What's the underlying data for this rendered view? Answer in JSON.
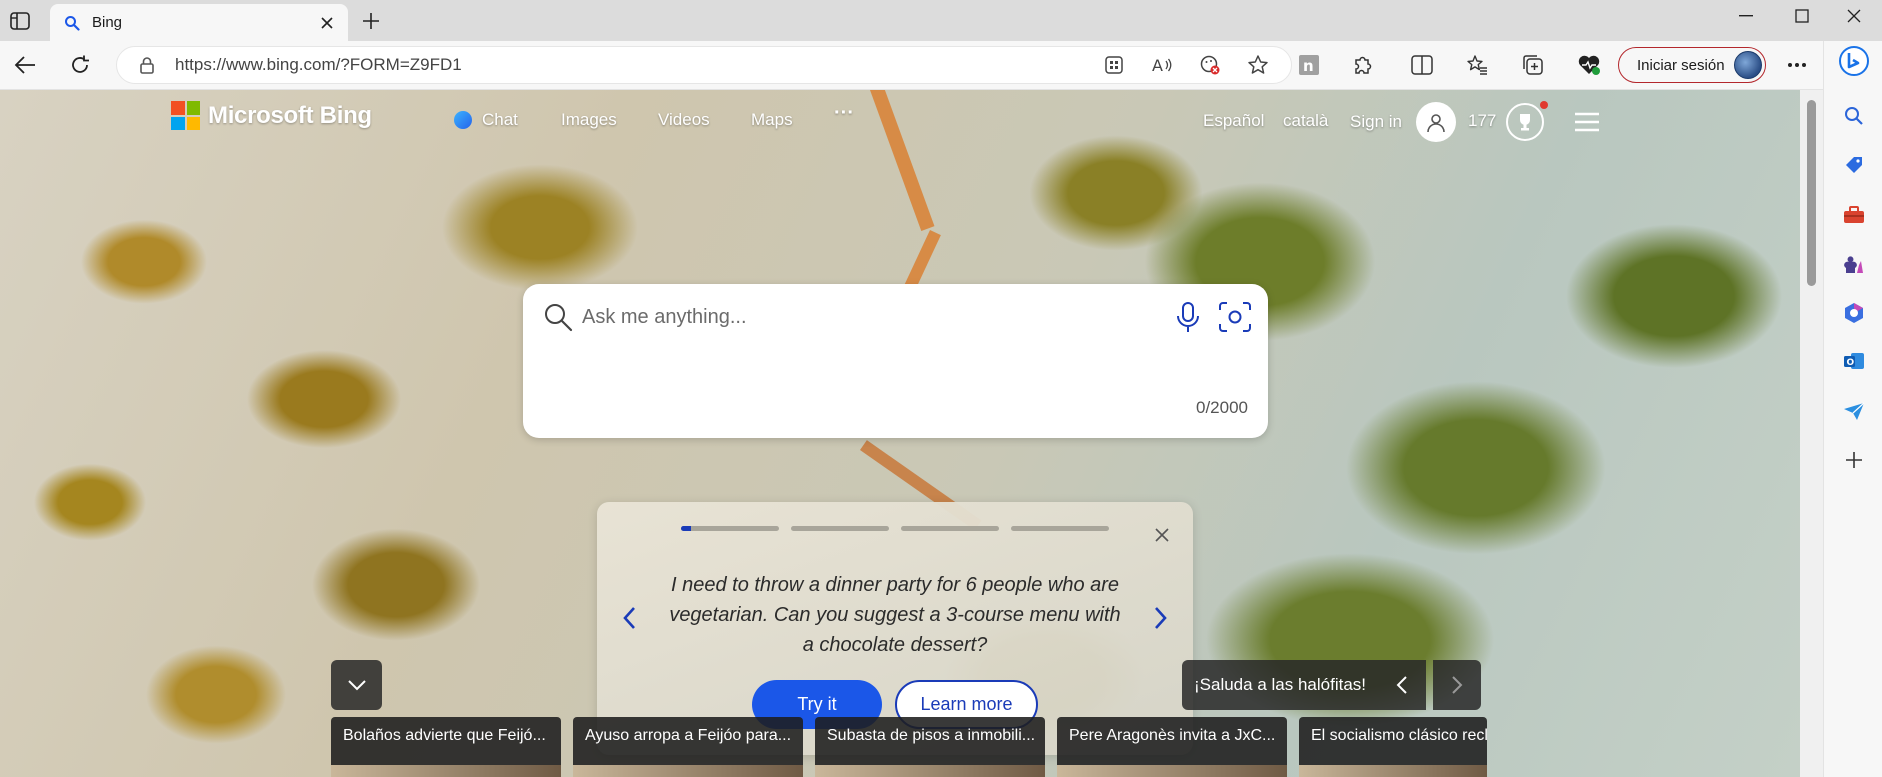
{
  "browser": {
    "tab_title": "Bing",
    "url": "https://www.bing.com/?FORM=Z9FD1",
    "signin_label": "Iniciar sesión"
  },
  "bing": {
    "brand": "Microsoft Bing",
    "nav": {
      "chat": "Chat",
      "images": "Images",
      "videos": "Videos",
      "maps": "Maps",
      "more": "···"
    },
    "header": {
      "lang1": "Español",
      "lang2": "català",
      "signin": "Sign in",
      "points": "177"
    },
    "search": {
      "placeholder": "Ask me anything...",
      "counter": "0/2000"
    },
    "suggestion": {
      "prompt": "I need to throw a dinner party for 6 people who are vegetarian. Can you suggest a 3-course menu with a chocolate dessert?",
      "try_label": "Try it",
      "learn_label": "Learn more",
      "progress": [
        0.1,
        0,
        0,
        0
      ]
    },
    "carousel": {
      "title": "¡Saluda a las halófitas!"
    },
    "news": [
      "Bolaños advierte que Feijó...",
      "Ayuso arropa a Feijóo para...",
      "Subasta de pisos a inmobili...",
      "Pere Aragonès invita a JxC...",
      "El socialismo clásico recl"
    ]
  },
  "colors": {
    "accent": "#1b57e8",
    "signin_border": "#b3272c"
  }
}
